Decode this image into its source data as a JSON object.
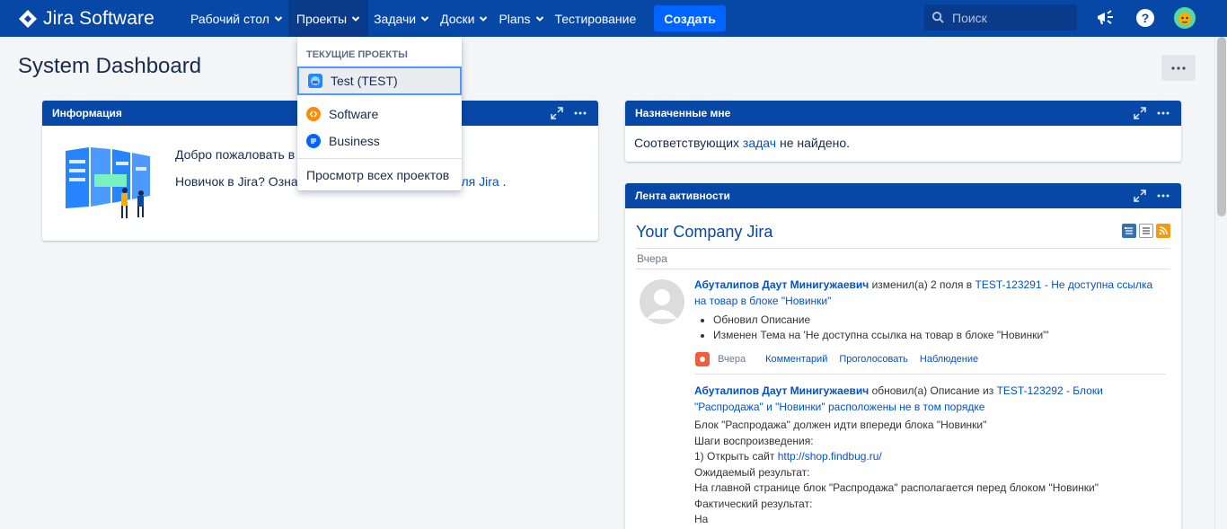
{
  "app": {
    "name": "Jira Software"
  },
  "nav": {
    "items": [
      {
        "label": "Рабочий стол",
        "has_menu": true
      },
      {
        "label": "Проекты",
        "has_menu": true,
        "active": true
      },
      {
        "label": "Задачи",
        "has_menu": true
      },
      {
        "label": "Доски",
        "has_menu": true
      },
      {
        "label": "Plans",
        "has_menu": true
      },
      {
        "label": "Тестирование",
        "has_menu": false
      }
    ],
    "create_label": "Создать",
    "search_placeholder": "Поиск"
  },
  "page": {
    "title": "System Dashboard"
  },
  "projects_menu": {
    "heading": "ТЕКУЩИЕ ПРОЕКТЫ",
    "items": [
      {
        "label": "Test (TEST)",
        "icon": "test-project-icon"
      },
      {
        "label": "Software",
        "icon": "software-project-icon"
      },
      {
        "label": "Business",
        "icon": "business-project-icon"
      }
    ],
    "view_all": "Просмотр всех проектов"
  },
  "info_gadget": {
    "title": "Информация",
    "welcome_visible": "Добро пожаловать в",
    "newbie_visible": "Новичок в Jira? Озна",
    "newbie_link_visible": "льзователя Jira",
    "newbie_tail": "."
  },
  "assigned_gadget": {
    "title": "Назначенные мне",
    "text_before": "Соответствующих",
    "link": "задач",
    "text_after": "не найдено."
  },
  "activity_gadget": {
    "title": "Лента активности",
    "stream_title": "Your Company Jira",
    "day": "Вчера",
    "entries": [
      {
        "user": "Абуталипов Даут Минигужаевич",
        "action": "изменил(а) 2 поля в",
        "issue_line1": "TEST-123291 - Не доступна ссылка",
        "issue_line2": "на товар в блоке \"Новинки\"",
        "changes": [
          "Обновил Описание",
          "Изменен Тема на 'Не доступна ссылка на товар в блоке \"Новинки\"'"
        ],
        "time": "Вчера",
        "links": [
          "Комментарий",
          "Проголосовать",
          "Наблюдение"
        ]
      },
      {
        "user": "Абуталипов Даут Минигужаевич",
        "action": "обновил(а) Описание из",
        "issue_line1": "TEST-123292 - Блоки",
        "issue_line2": "\"Распродажа\" и \"Новинки\" расположены не в том порядке",
        "body": [
          "Блок \"Распродажа\" должен идти впереди блока \"Новинки\"",
          "Шаги воспроизведения:",
          "1) Открыть сайт",
          "Ожидаемый результат:",
          "На главной странице блок \"Распродажа\" располагается перед блоком \"Новинки\"",
          "Фактический результат:",
          "На"
        ],
        "body_link": "http://shop.findbug.ru/"
      }
    ]
  },
  "colors": {
    "header": "#0747a6",
    "create": "#0065ff",
    "link": "#0052cc"
  }
}
